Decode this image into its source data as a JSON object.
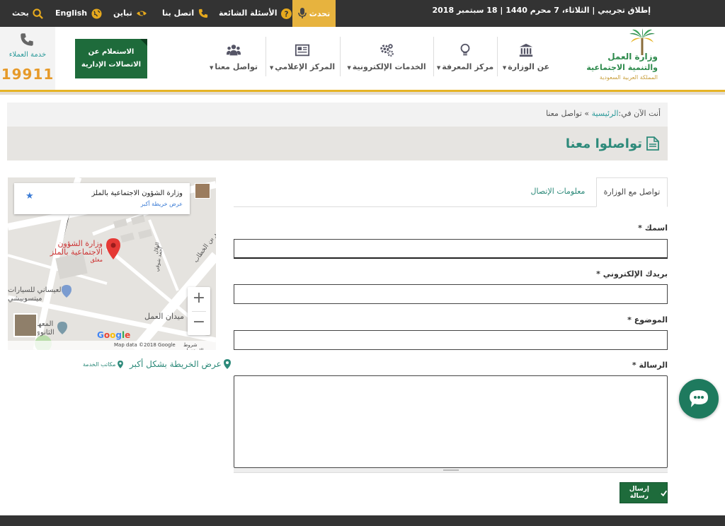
{
  "topbar": {
    "date": "إطلاق تجريبي | الثلاثاء، 7 محرم 1440 | 18 سبتمبر 2018",
    "talk": "تحدث",
    "faq": "الأسئلة الشائعة",
    "contact": "اتصل بنا",
    "contrast": "تباين",
    "english": "English",
    "search": "بحث"
  },
  "logo": {
    "line1": "وزارة العمل",
    "line2": "والتنمية الاجتماعية",
    "line3": "المملكة العربية السعودية"
  },
  "nav": {
    "ministry": "عن الوزارة",
    "knowledge": "مركز المعرفة",
    "eservices": "الخدمات الإلكترونية",
    "media": "المركز الإعلامي",
    "contact": "تواصل معنا"
  },
  "service_box": {
    "line1": "الاستعلام عن",
    "line2": "الاتصالات الإدارية"
  },
  "hotline": {
    "label": "خدمة العملاء",
    "number": "19911"
  },
  "breadcrumb": {
    "prefix": "أنت الآن في:",
    "home": "الرئيسية",
    "sep": " » ",
    "current": "تواصل معنا"
  },
  "page_title": "تواصلوا معنا",
  "tabs": {
    "contact_ministry": "تواصل مع الوزارة",
    "contact_info": "معلومات الإتصال"
  },
  "form": {
    "name_label": "اسمك",
    "email_label": "بريدك الإلكتروني",
    "subject_label": "الموضوع",
    "message_label": "الرسالة",
    "required": "*",
    "name_value": "",
    "email_value": "",
    "subject_value": "",
    "message_value": "",
    "send_label": "إرسال رسالة"
  },
  "map": {
    "card_title": "وزارة الشؤون الاجتماعية بالملز",
    "card_link": "عرض خريطة أكبر",
    "pin_line1": "وزارة الشؤون",
    "pin_line2": "الاجتماعية بالملز",
    "pin_status": "مغلق",
    "street1": "عمر بن الخطاب",
    "street2": "ميدان العمل",
    "place1": "العيساني للسيارات",
    "place1b": "ميتسوبيشي",
    "place2": "المعهد",
    "place2b": "الثانوي",
    "street3": "احمد شوقي",
    "street4": "الهلال",
    "google": "Google",
    "attrib": "Map data ©2018 Google",
    "terms": "شروط الاستخدام",
    "zoom_in": "+",
    "zoom_out": "−",
    "view_larger": "عرض الخريطة بشكل أكبر",
    "service_offices": "مكاتب الخدمة"
  },
  "colors": {
    "topbar": "#333333",
    "accent_gold": "#e7b33e",
    "brand_green": "#1e6b3b",
    "teal": "#2d8a7a"
  }
}
